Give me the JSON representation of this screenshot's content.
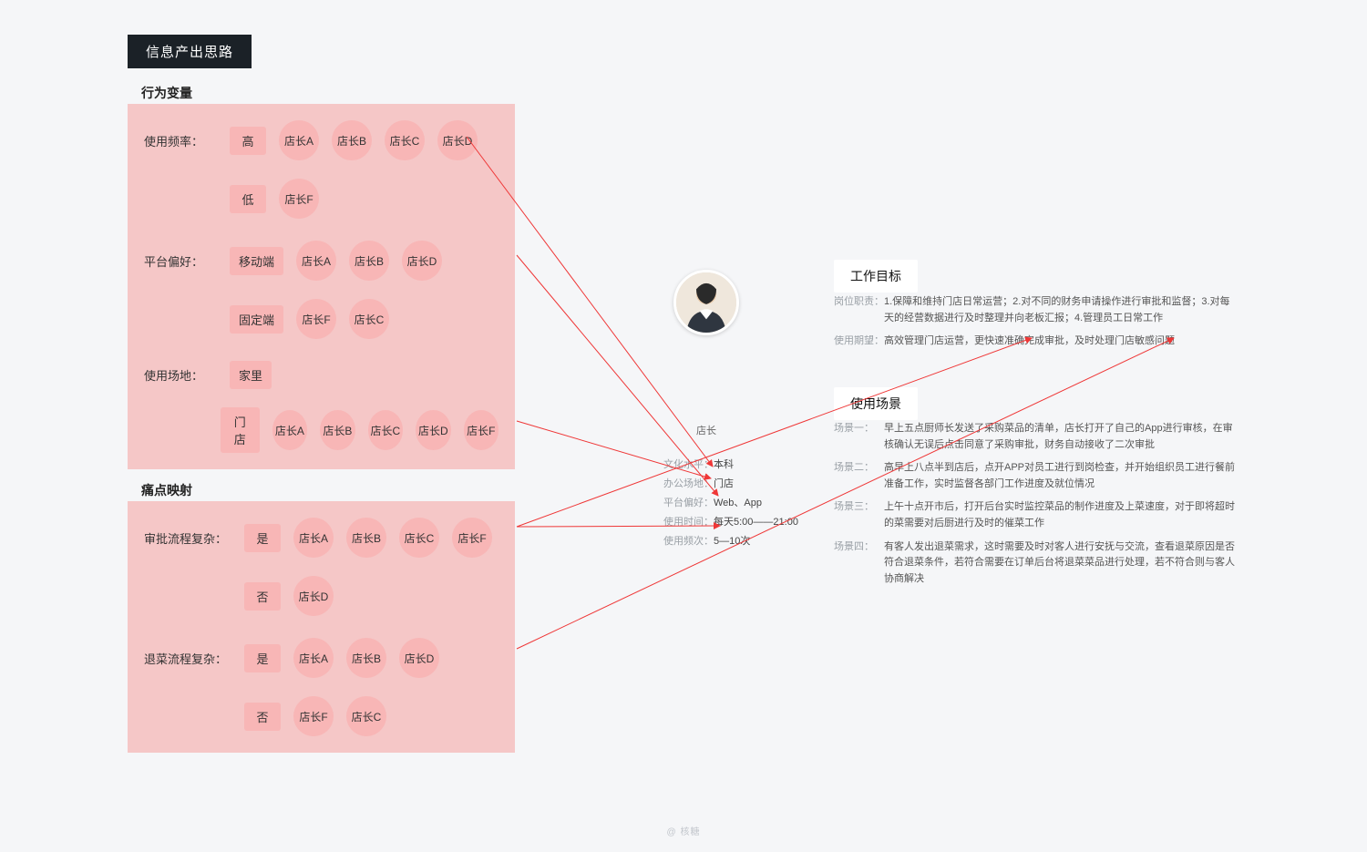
{
  "title_badge": "信息产出思路",
  "sections": {
    "behavior_label": "行为变量",
    "pain_label": "痛点映射"
  },
  "cards": {
    "freq": {
      "title": "使用频率：",
      "rows": [
        {
          "tag": "高",
          "bubbles": [
            "店长A",
            "店长B",
            "店长C",
            "店长D"
          ]
        },
        {
          "tag": "低",
          "bubbles": [
            "店长F"
          ]
        }
      ]
    },
    "platform": {
      "title": "平台偏好：",
      "rows": [
        {
          "tag": "移动端",
          "bubbles": [
            "店长A",
            "店长B",
            "店长D"
          ]
        },
        {
          "tag": "固定端",
          "bubbles": [
            "店长F",
            "店长C"
          ]
        }
      ]
    },
    "place": {
      "title": "使用场地：",
      "rows": [
        {
          "tag": "家里",
          "bubbles": []
        },
        {
          "tag": "门店",
          "bubbles": [
            "店长A",
            "店长B",
            "店长C",
            "店长D",
            "店长F"
          ]
        }
      ]
    },
    "approve": {
      "title": "审批流程复杂：",
      "rows": [
        {
          "tag": "是",
          "bubbles": [
            "店长A",
            "店长B",
            "店长C",
            "店长F"
          ]
        },
        {
          "tag": "否",
          "bubbles": [
            "店长D"
          ]
        }
      ]
    },
    "refund": {
      "title": "退菜流程复杂：",
      "rows": [
        {
          "tag": "是",
          "bubbles": [
            "店长A",
            "店长B",
            "店长D"
          ]
        },
        {
          "tag": "否",
          "bubbles": [
            "店长F",
            "店长C"
          ]
        }
      ]
    }
  },
  "persona": {
    "role": "店长",
    "attrs": {
      "edu_k": "文化水平：",
      "edu_v": "本科",
      "loc_k": "办公场地：",
      "loc_v": "门店",
      "plat_k": "平台偏好：",
      "plat_v": "Web、App",
      "time_k": "使用时间：",
      "time_v": "每天5:00——21:00",
      "freq_k": "使用频次：",
      "freq_v": "5—10次"
    }
  },
  "right": {
    "goals_title": "工作目标",
    "goals": {
      "g1_k": "岗位职责：",
      "g1_v": "1.保障和维持门店日常运营；2.对不同的财务申请操作进行审批和监督；3.对每天的经营数据进行及时整理并向老板汇报；4.管理员工日常工作",
      "g2_k": "使用期望：",
      "g2_v": "高效管理门店运营，更快速准确完成审批，及时处理门店敏感问题"
    },
    "scenes_title": "使用场景",
    "scenes": {
      "s1_k": "场景一：",
      "s1_v": "早上五点厨师长发送了采购菜品的清单，店长打开了自己的App进行审核，在审核确认无误后点击同意了采购审批，财务自动接收了二次审批",
      "s2_k": "场景二：",
      "s2_v": "高早上八点半到店后，点开APP对员工进行到岗检查，并开始组织员工进行餐前准备工作，实时监督各部门工作进度及就位情况",
      "s3_k": "场景三：",
      "s3_v": "上午十点开市后，打开后台实时监控菜品的制作进度及上菜速度，对于即将超时的菜需要对后厨进行及时的催菜工作",
      "s4_k": "场景四：",
      "s4_v": "有客人发出退菜需求，这时需要及时对客人进行安抚与交流，查看退菜原因是否符合退菜条件，若符合需要在订单后台将退菜菜品进行处理，若不符合则与客人协商解决"
    }
  },
  "footer": "@ 核糖"
}
